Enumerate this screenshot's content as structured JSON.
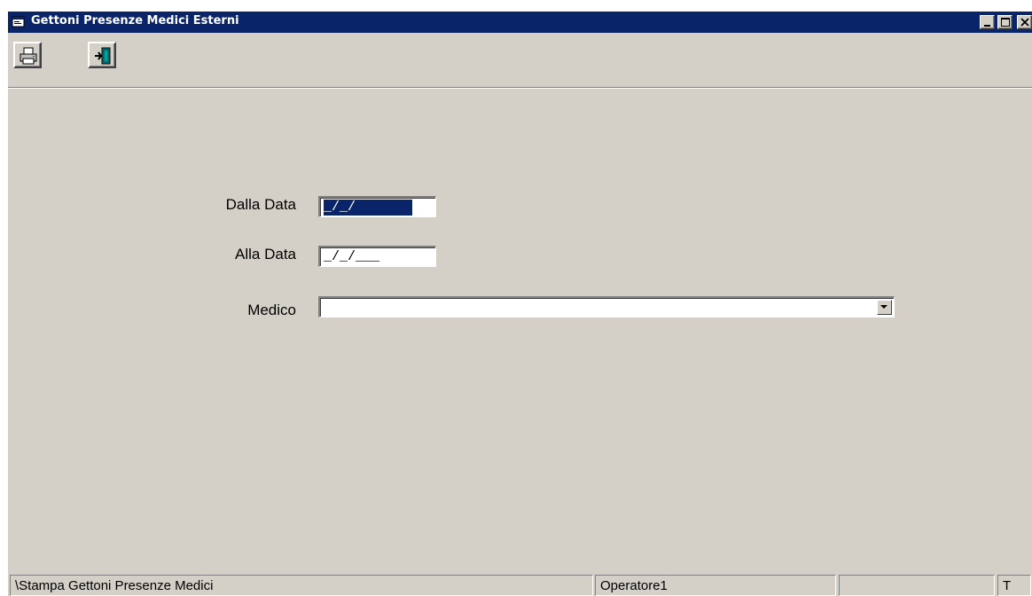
{
  "window": {
    "title": "Gettoni Presenze Medici Esterni",
    "icons": {
      "app": "app-window-icon",
      "minimize": "minimize-icon",
      "maximize": "maximize-icon",
      "close": "close-icon"
    }
  },
  "toolbar": {
    "buttons": [
      {
        "name": "print",
        "icon": "printer-icon"
      },
      {
        "name": "exit",
        "icon": "exit-door-icon"
      }
    ]
  },
  "form": {
    "from_date": {
      "label": "Dalla Data",
      "value": "_/_/"
    },
    "to_date": {
      "label": "Alla Data",
      "value": "_/_/___"
    },
    "doctor": {
      "label": "Medico",
      "value": ""
    }
  },
  "statusbar": {
    "path": "\\Stampa Gettoni Presenze Medici",
    "operator": "Operatore1",
    "empty": "",
    "mode": "T"
  },
  "colors": {
    "titlebar": "#0a246a",
    "face": "#d4d0c8",
    "selection": "#0a246a"
  }
}
